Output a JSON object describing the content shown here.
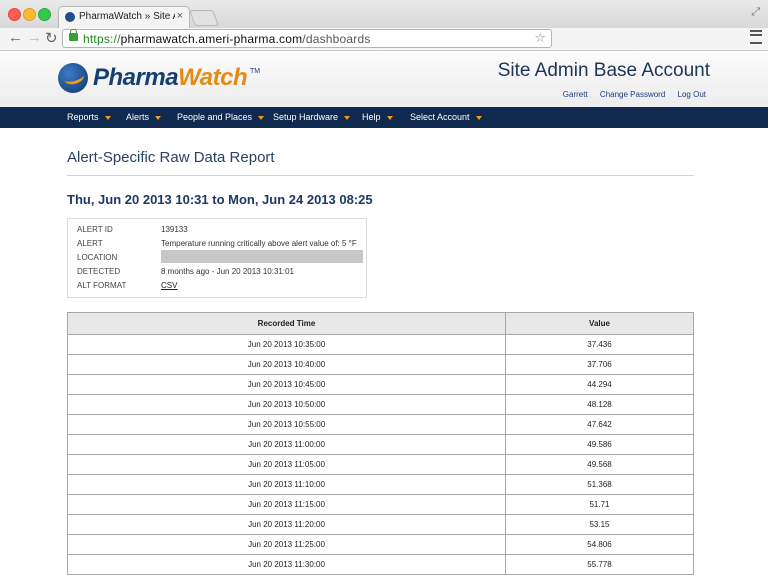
{
  "browser": {
    "tab_title": "PharmaWatch » Site Admin",
    "tab_close": "×",
    "url_scheme": "https://",
    "url_host": "pharmawatch.ameri-pharma.com",
    "url_path": "/dashboards",
    "back": "←",
    "forward": "→",
    "reload": "↻",
    "star": "☆",
    "fullscreen": "⤢"
  },
  "header": {
    "logo_a": "Pharma",
    "logo_b": "Watch",
    "logo_tm": "TM",
    "account_title": "Site Admin Base Account",
    "user_links": [
      "Garrett",
      "Change Password",
      "Log Out"
    ]
  },
  "nav": {
    "items": [
      "Reports",
      "Alerts",
      "People and Places",
      "Setup Hardware",
      "Help",
      "Select Account"
    ]
  },
  "report": {
    "title": "Alert-Specific Raw Data Report",
    "date_range": "Thu, Jun 20 2013 10:31 to Mon, Jun 24 2013 08:25",
    "info": {
      "alert_id_label": "ALERT ID",
      "alert_id": "139133",
      "alert_label": "ALERT",
      "alert": "Temperature running critically above alert value of: 5 °F",
      "location_label": "LOCATION",
      "detected_label": "DETECTED",
      "detected": "8 months ago - Jun 20 2013 10:31:01",
      "alt_format_label": "ALT FORMAT",
      "alt_format": "CSV"
    },
    "table": {
      "headers": [
        "Recorded Time",
        "Value"
      ],
      "rows": [
        [
          "Jun 20 2013 10:35:00",
          "37.436"
        ],
        [
          "Jun 20 2013 10:40:00",
          "37.706"
        ],
        [
          "Jun 20 2013 10:45:00",
          "44.294"
        ],
        [
          "Jun 20 2013 10:50:00",
          "48.128"
        ],
        [
          "Jun 20 2013 10:55:00",
          "47.642"
        ],
        [
          "Jun 20 2013 11:00:00",
          "49.586"
        ],
        [
          "Jun 20 2013 11:05:00",
          "49.568"
        ],
        [
          "Jun 20 2013 11:10:00",
          "51.368"
        ],
        [
          "Jun 20 2013 11:15:00",
          "51.71"
        ],
        [
          "Jun 20 2013 11:20:00",
          "53.15"
        ],
        [
          "Jun 20 2013 11:25:00",
          "54.806"
        ],
        [
          "Jun 20 2013 11:30:00",
          "55.778"
        ]
      ]
    }
  }
}
